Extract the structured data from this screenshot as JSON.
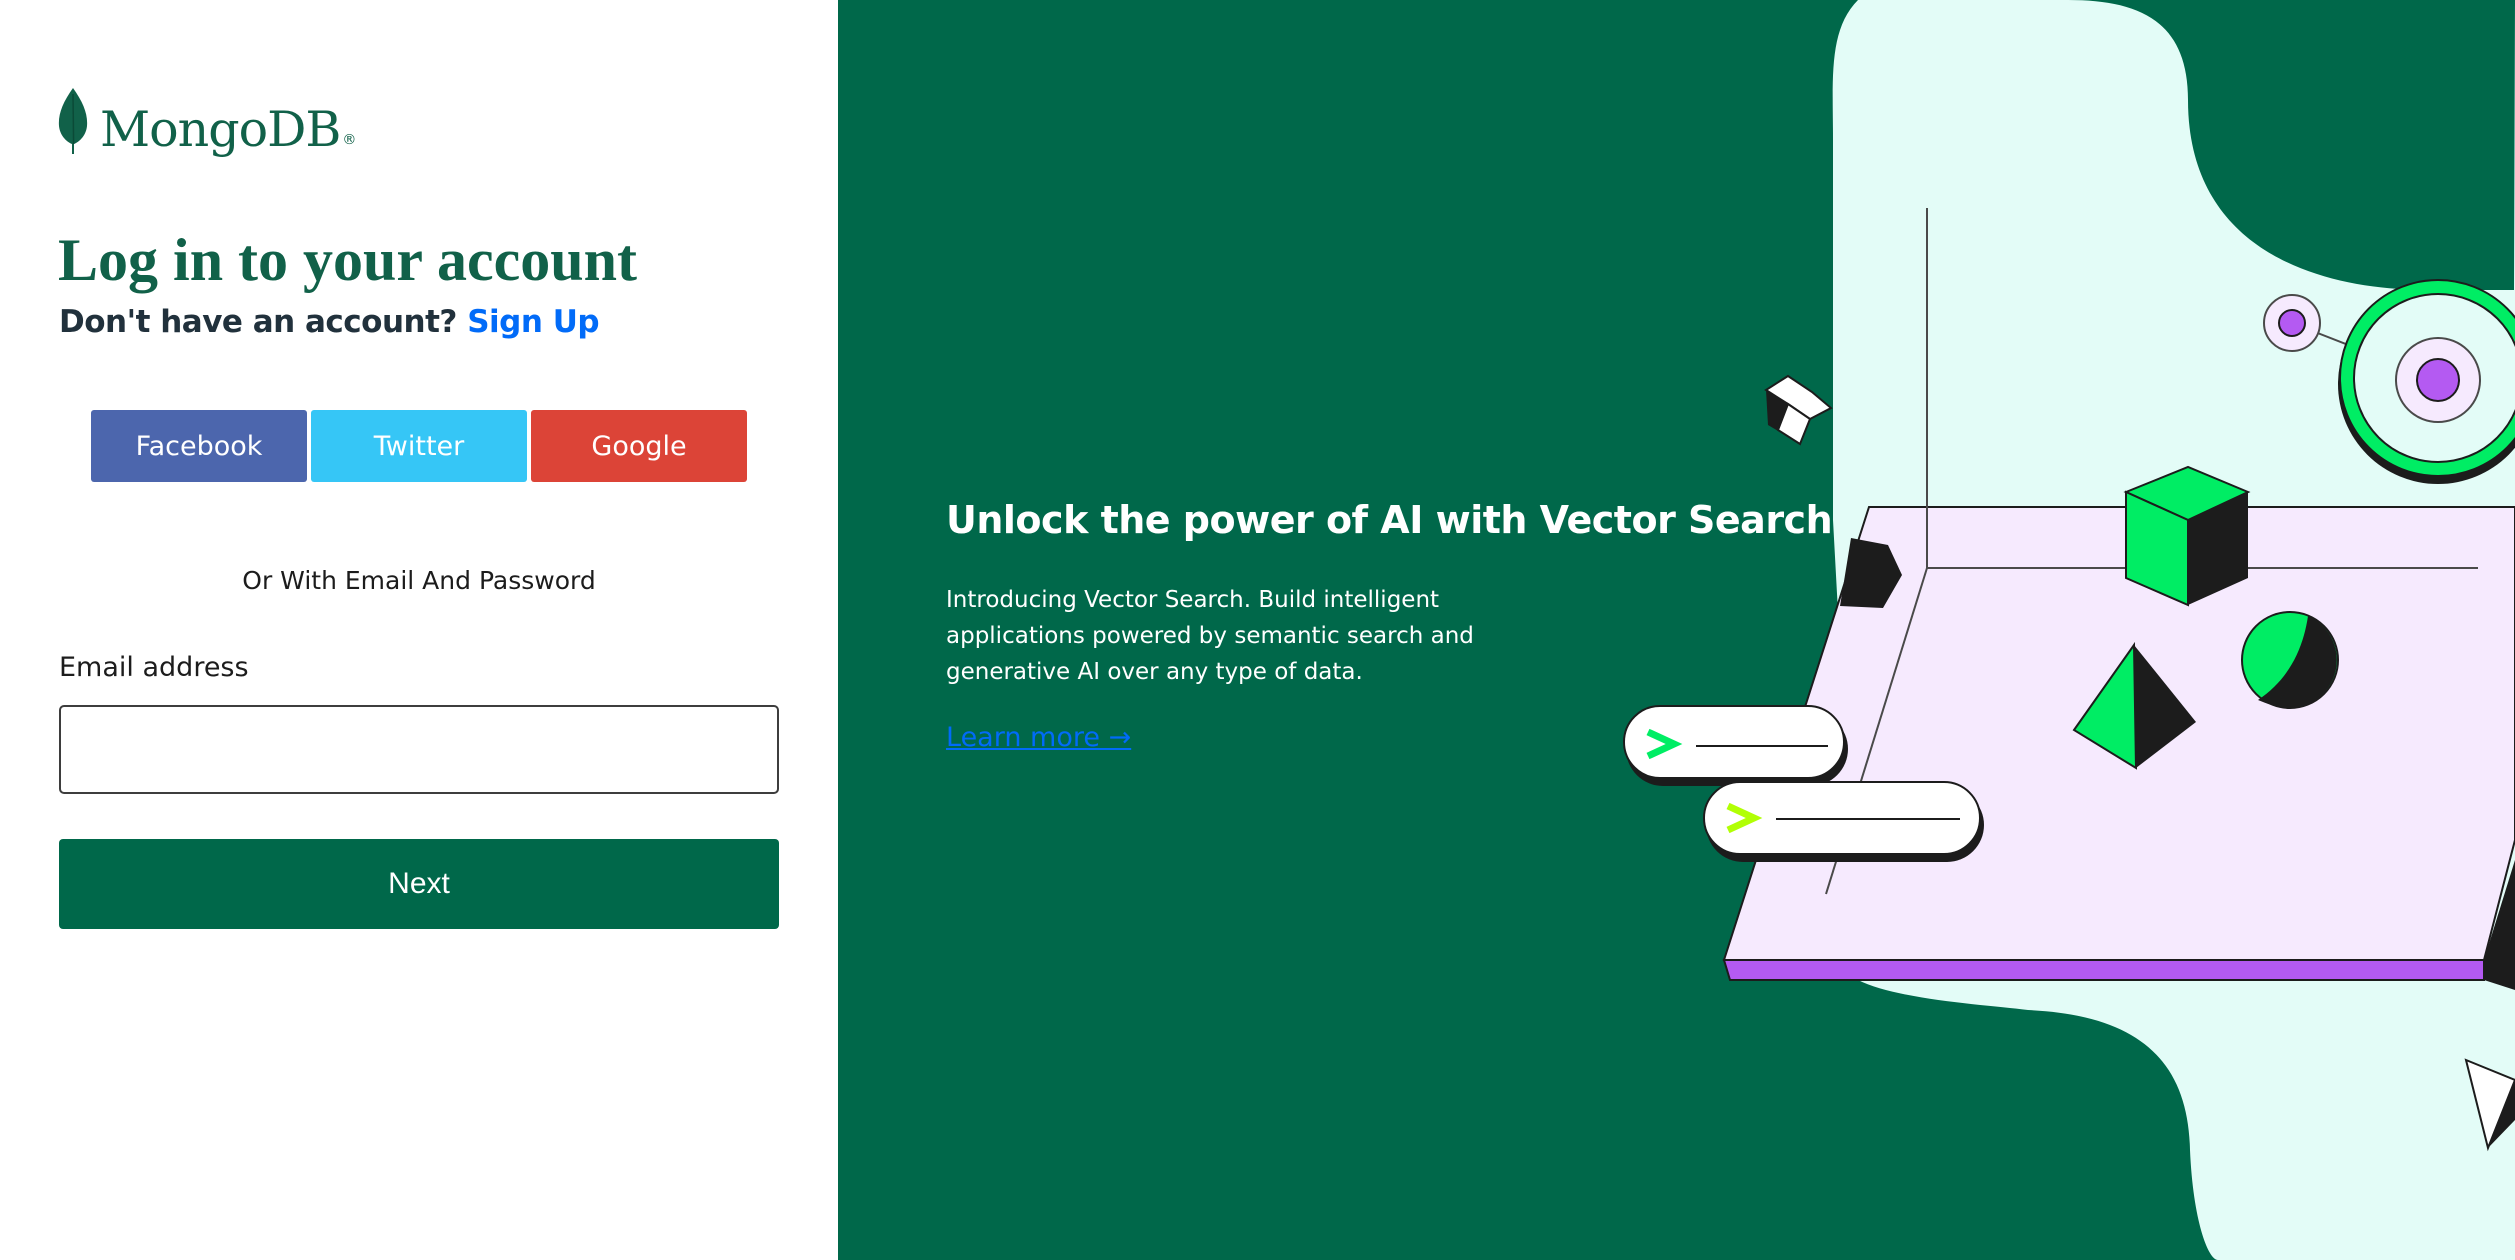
{
  "brand": {
    "name": "MongoDB",
    "registered": "®",
    "logo_icon": "leaf-icon",
    "color": "#116149"
  },
  "login": {
    "title": "Log in to your account",
    "subtitle_prefix": "Don't have an account?",
    "signup_label": "Sign Up",
    "social": {
      "facebook_label": "Facebook",
      "twitter_label": "Twitter",
      "google_label": "Google"
    },
    "divider_text": "Or With Email And Password",
    "email_label": "Email address",
    "email_value": "",
    "next_label": "Next"
  },
  "promo": {
    "title": "Unlock the power of AI with Vector Search",
    "body": "Introducing Vector Search. Build intelligent applications powered by semantic search and generative AI over any type of data.",
    "link_label": "Learn more →"
  },
  "colors": {
    "primary_green": "#00684a",
    "link_blue": "#016bf8",
    "facebook": "#4c66ad",
    "twitter": "#36c6f6",
    "google": "#dc4437",
    "mint": "#e3fcf7",
    "lavender": "#f6eafe",
    "purple": "#b45af2",
    "bright_green": "#00ed64"
  }
}
